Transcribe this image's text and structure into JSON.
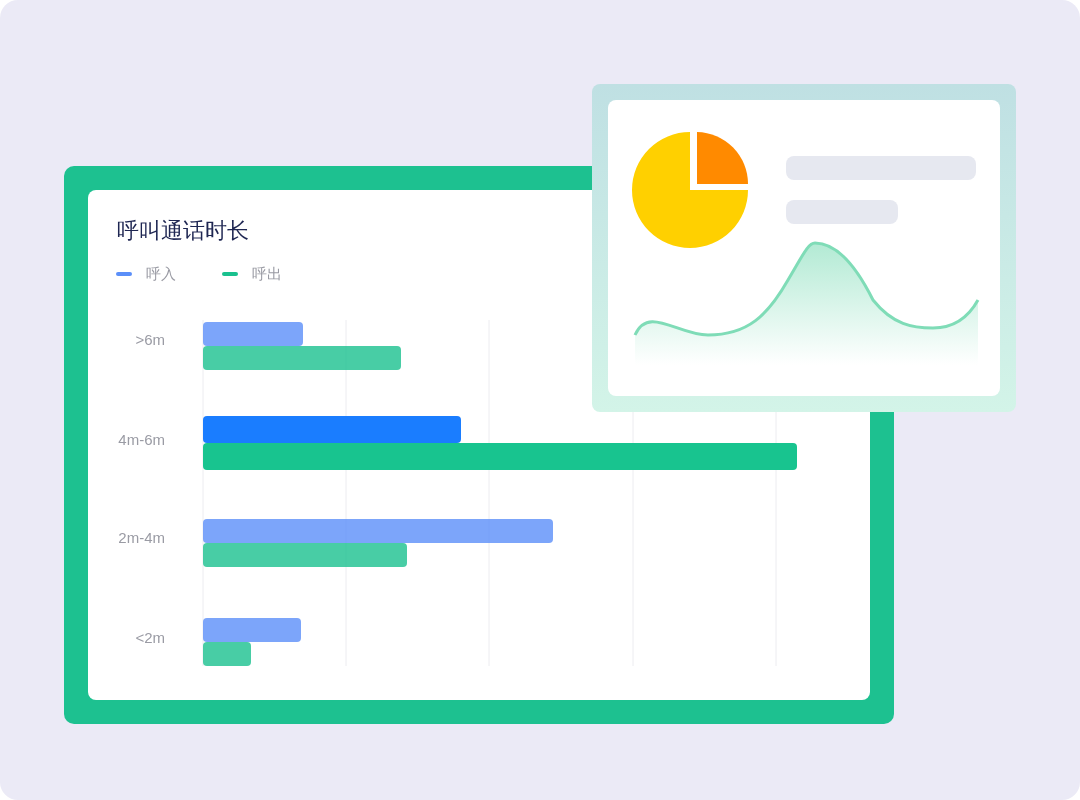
{
  "chart_card": {
    "title": "呼叫通话时长",
    "legend": [
      {
        "label": "呼入",
        "color": "#5b8ff9"
      },
      {
        "label": "呼出",
        "color": "#1ac18e"
      }
    ],
    "categories": [
      {
        "label": ">6m",
        "selected": false
      },
      {
        "label": "4m-6m",
        "selected": true
      },
      {
        "label": "2m-4m",
        "selected": false
      },
      {
        "label": "<2m",
        "selected": false
      }
    ]
  }
}
